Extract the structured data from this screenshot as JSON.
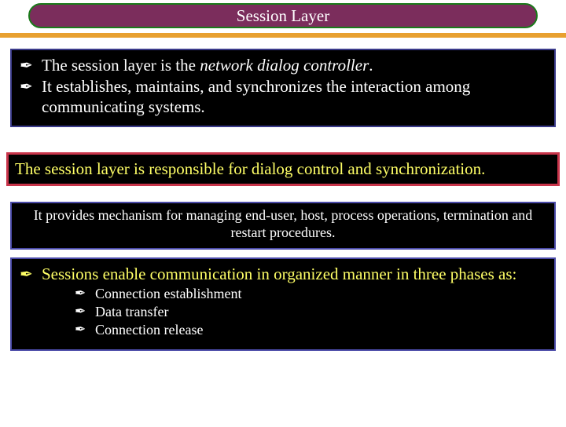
{
  "title": "Session Layer",
  "box1": {
    "line1_pre": "The session layer is the ",
    "line1_em": "network dialog controller",
    "line1_post": ".",
    "line2": "It establishes, maintains, and synchronizes the interaction among communicating systems."
  },
  "box2": "The session layer is responsible for dialog control and synchronization.",
  "box3": "It provides mechanism for managing end-user, host, process operations, termination and restart procedures.",
  "box4": {
    "intro": "Sessions enable communication in organized manner in three phases as:",
    "items": [
      "Connection establishment",
      "Data transfer",
      "Connection release"
    ]
  },
  "bullet_glyph": "✒"
}
